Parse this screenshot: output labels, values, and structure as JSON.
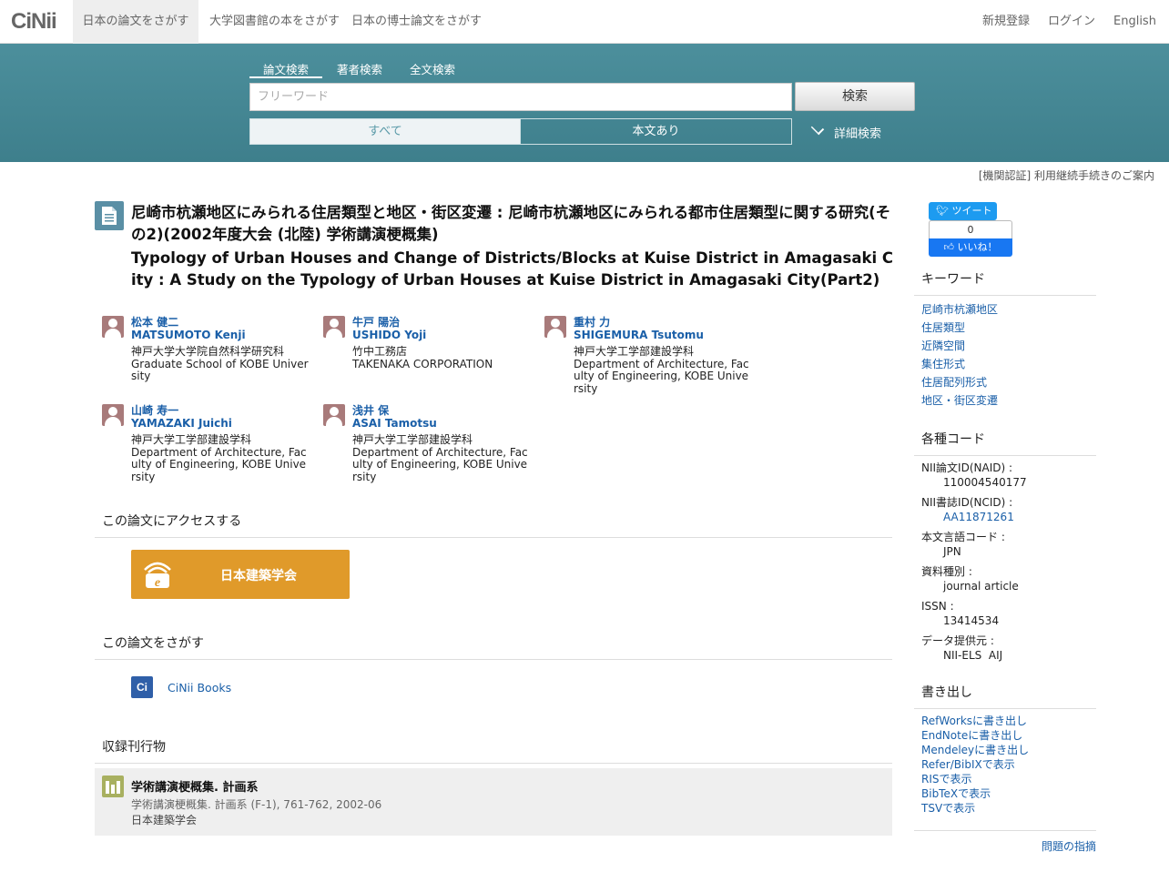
{
  "nav": {
    "logo": "CiNii",
    "tabs": [
      "日本の論文をさがす",
      "大学図書館の本をさがす",
      "日本の博士論文をさがす"
    ],
    "right": [
      "新規登録",
      "ログイン",
      "English"
    ]
  },
  "search": {
    "tabs": [
      "論文検索",
      "著者検索",
      "全文検索"
    ],
    "placeholder": "フリーワード",
    "button": "検索",
    "filters": [
      "すべて",
      "本文あり"
    ],
    "advanced": "詳細検索"
  },
  "institution_notice": "[機関認証] 利用継続手続きのご案内",
  "article": {
    "title_ja": "尼崎市杭瀬地区にみられる住居類型と地区・街区変遷 : 尼崎市杭瀬地区にみられる都市住居類型に関する研究(その2)(2002年度大会 (北陸) 学術講演梗概集)",
    "title_en": "Typology of Urban Houses and Change of Districts/Blocks at Kuise District in Amagasaki City : A Study on the Typology of Urban Houses at Kuise District in Amagasaki City(Part2)"
  },
  "authors": [
    {
      "name_ja": "松本 健二",
      "name_en": "MATSUMOTO Kenji",
      "aff_ja": "神戸大学大学院自然科学研究科",
      "aff_en": "Graduate School of KOBE University"
    },
    {
      "name_ja": "牛戸 陽治",
      "name_en": "USHIDO Yoji",
      "aff_ja": "竹中工務店",
      "aff_en": "TAKENAKA CORPORATION"
    },
    {
      "name_ja": "重村 力",
      "name_en": "SHIGEMURA Tsutomu",
      "aff_ja": "神戸大学工学部建設学科",
      "aff_en": "Department of Architecture, Faculty of Engineering, KOBE University"
    },
    {
      "name_ja": "山崎 寿一",
      "name_en": "YAMAZAKI Juichi",
      "aff_ja": "神戸大学工学部建設学科",
      "aff_en": "Department of Architecture, Faculty of Engineering, KOBE University"
    },
    {
      "name_ja": "浅井 保",
      "name_en": "ASAI Tamotsu",
      "aff_ja": "神戸大学工学部建設学科",
      "aff_en": "Department of Architecture, Faculty of Engineering, KOBE University"
    }
  ],
  "access": {
    "heading": "この論文にアクセスする",
    "button": "日本建築学会"
  },
  "find": {
    "heading": "この論文をさがす",
    "link": "CiNii Books",
    "icon_letter": "Ci"
  },
  "journal": {
    "heading": "収録刊行物",
    "title": "学術講演梗概集. 計画系",
    "detail": "学術講演梗概集. 計画系 (F-1), 761-762, 2002-06",
    "publisher": "日本建築学会"
  },
  "social": {
    "tweet": "ツイート",
    "like_count": "0",
    "like": "いいね！"
  },
  "keywords": {
    "heading": "キーワード",
    "items": [
      "尼崎市杭瀬地区",
      "住居類型",
      "近隣空間",
      "集住形式",
      "住居配列形式",
      "地区・街区変遷"
    ]
  },
  "codes": {
    "heading": "各種コード",
    "items": [
      {
        "label": "NII論文ID(NAID) :",
        "value": "110004540177"
      },
      {
        "label": "NII書誌ID(NCID) :",
        "value": "AA11871261"
      },
      {
        "label": "本文言語コード :",
        "value": "JPN"
      },
      {
        "label": "資料種別 :",
        "value": "journal article"
      },
      {
        "label": "ISSN :",
        "value": "13414534"
      },
      {
        "label": "データ提供元 :",
        "value": "NII-ELS  AIJ"
      }
    ]
  },
  "export": {
    "heading": "書き出し",
    "items": [
      "RefWorksに書き出し",
      "EndNoteに書き出し",
      "Mendeleyに書き出し",
      "Refer/BibIXで表示",
      "RISで表示",
      "BibTeXで表示",
      "TSVで表示"
    ]
  },
  "report_issue": "問題の指摘",
  "colors": {
    "band": "#468896",
    "accent_link": "#1a5fa8",
    "access_button": "#e09a2a"
  }
}
